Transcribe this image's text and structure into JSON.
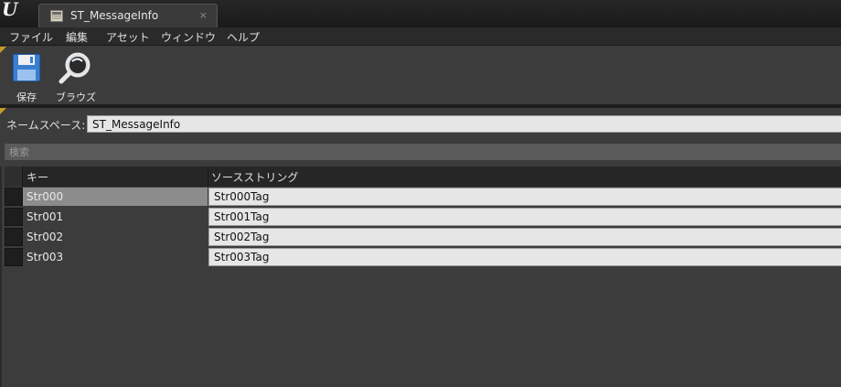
{
  "window": {
    "tab_title": "ST_MessageInfo",
    "tab_close": "×"
  },
  "menu": [
    "ファイル",
    "編集",
    "アセット",
    "ウィンドウ",
    "ヘルプ"
  ],
  "toolbar": {
    "save_label": "保存",
    "browse_label": "ブラウズ"
  },
  "namespace": {
    "label": "ネームスペース:",
    "value": "ST_MessageInfo"
  },
  "search": {
    "placeholder": "検索"
  },
  "table": {
    "headers": {
      "key": "キー",
      "source": "ソースストリング"
    },
    "rows": [
      {
        "key": "Str000",
        "source": "Str000Tag"
      },
      {
        "key": "Str001",
        "source": "Str001Tag"
      },
      {
        "key": "Str002",
        "source": "Str002Tag"
      },
      {
        "key": "Str003",
        "source": "Str003Tag"
      }
    ],
    "selected_row": 0
  },
  "colors": {
    "accent": "#c89a28",
    "panel": "#3c3c3c",
    "selected": "#8c8c8c"
  }
}
